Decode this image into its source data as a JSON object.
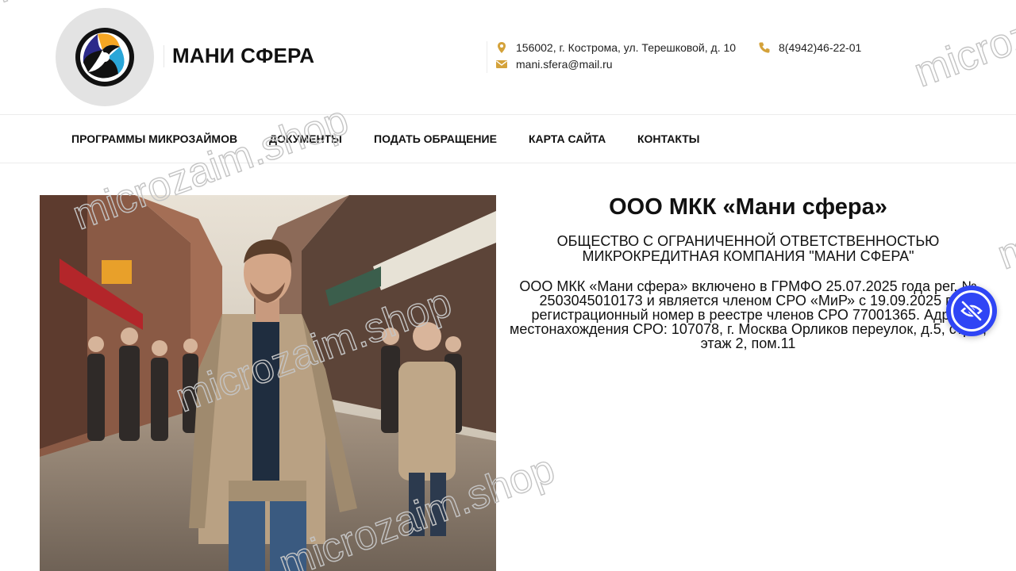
{
  "header": {
    "brand_name": "МАНИ СФЕРА",
    "logo": {
      "icon": "tri-blade-logo",
      "colors": [
        "#f6a623",
        "#2aa6d8",
        "#2c2a8a",
        "#111111"
      ]
    },
    "contacts": {
      "address": "156002, г. Кострома, ул. Терешковой, д. 10",
      "email": "mani.sfera@mail.ru",
      "phone": "8(4942)46-22-01",
      "icon_color": "#d4a23a"
    }
  },
  "nav": {
    "items": [
      {
        "label": "ПРОГРАММЫ МИКРОЗАЙМОВ"
      },
      {
        "label": "ДОКУМЕНТЫ"
      },
      {
        "label": "ПОДАТЬ ОБРАЩЕНИЕ"
      },
      {
        "label": "КАРТА САЙТА"
      },
      {
        "label": "КОНТАКТЫ"
      }
    ]
  },
  "main": {
    "photo": {
      "icon": "street-portrait-photo"
    },
    "title": "ООО МКК «Мани сфера»",
    "subtitle": "ОБЩЕСТВО С ОГРАНИЧЕННОЙ ОТВЕТСТВЕННОСТЬЮ МИКРОКРЕДИТНАЯ КОМПАНИЯ \"МАНИ СФЕРА\"",
    "body": "ООО МКК «Мани сфера» включено в ГРМФО 25.07.2025 года рег. № 2503045010173 и является членом СРО «МиР» с 19.09.2025 г., регистрационный номер в реестре членов СРО 77001365. Адрес местонахождения СРО: 107078, г. Москва Орликов переулок, д.5, стр.1, этаж 2, пом.11"
  },
  "accessibility_button": {
    "icon": "eye-off-icon",
    "color": "#2f45f5"
  },
  "watermark": {
    "text": "microzaim.shop"
  }
}
